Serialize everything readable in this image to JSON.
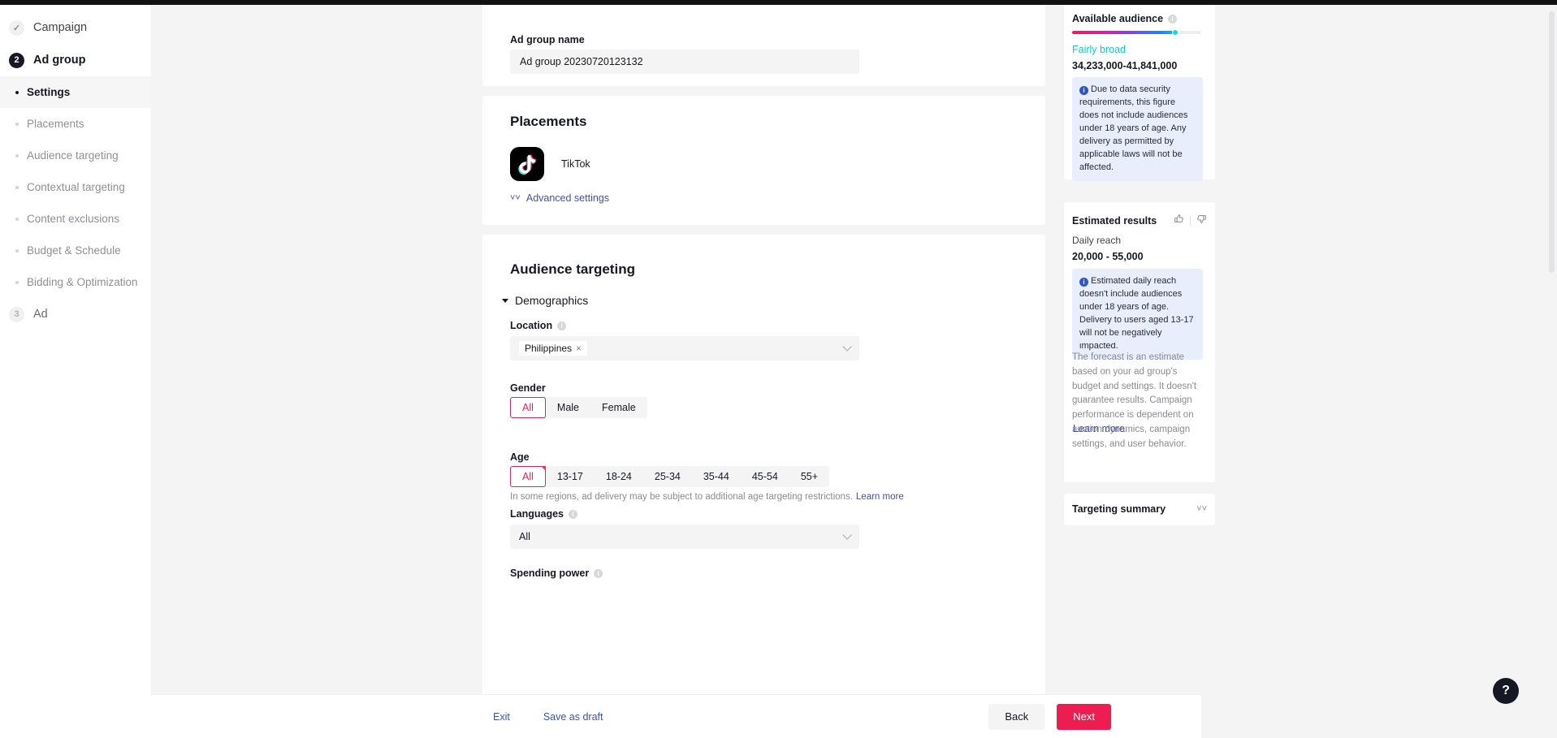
{
  "sidebar": {
    "steps": [
      {
        "badge": "✓",
        "label": "Campaign",
        "state": "done"
      },
      {
        "badge": "2",
        "label": "Ad group",
        "state": "active"
      }
    ],
    "sub_items": [
      {
        "label": "Settings",
        "selected": true
      },
      {
        "label": "Placements",
        "selected": false
      },
      {
        "label": "Audience targeting",
        "selected": false
      },
      {
        "label": "Contextual targeting",
        "selected": false
      },
      {
        "label": "Content exclusions",
        "selected": false
      },
      {
        "label": "Budget & Schedule",
        "selected": false
      },
      {
        "label": "Bidding & Optimization",
        "selected": false
      }
    ],
    "last_step": {
      "badge": "3",
      "label": "Ad",
      "state": "todo"
    }
  },
  "ad_group_name": {
    "label": "Ad group name",
    "value": "Ad group 20230720123132"
  },
  "placements": {
    "title": "Placements",
    "platform": "TikTok",
    "advanced_settings": "Advanced settings"
  },
  "audience_targeting": {
    "title": "Audience targeting",
    "demographics_label": "Demographics",
    "location": {
      "label": "Location",
      "tag": "Philippines",
      "remove": "×"
    },
    "gender": {
      "label": "Gender",
      "options": [
        "All",
        "Male",
        "Female"
      ],
      "selected": "All"
    },
    "age": {
      "label": "Age",
      "options": [
        "All",
        "13-17",
        "18-24",
        "25-34",
        "35-44",
        "45-54",
        "55+"
      ],
      "selected": "All",
      "hint": "In some regions, ad delivery may be subject to additional age targeting restrictions.",
      "hint_link": "Learn more"
    },
    "languages": {
      "label": "Languages",
      "value": "All"
    },
    "spending_power": {
      "label": "Spending power"
    }
  },
  "right_panel": {
    "available_audience": {
      "title": "Available audience",
      "breadth": "Fairly broad",
      "range": "34,233,000-41,841,000",
      "notice": "Due to data security requirements, this figure does not include audiences under 18 years of age. Any delivery as permitted by applicable laws will not be affected.",
      "slider_percent": 78
    },
    "estimated_results": {
      "title": "Estimated results",
      "metric_label": "Daily reach",
      "metric_value": "20,000 - 55,000",
      "notice": "Estimated daily reach doesn't include audiences under 18 years of age. Delivery to users aged 13-17 will not be negatively impacted.",
      "disclaimer": "The forecast is an estimate based on your ad group's budget and settings. It doesn't guarantee results. Campaign performance is dependent on auction dynamics, campaign settings, and user behavior.",
      "learn_more": "Learn more"
    },
    "targeting_summary": {
      "title": "Targeting summary"
    }
  },
  "footer": {
    "exit": "Exit",
    "save_as_draft": "Save as draft",
    "back": "Back",
    "next": "Next"
  },
  "help": {
    "glyph": "?"
  },
  "colors": {
    "accent_pink": "#ee1d51",
    "selected_pill": "#d6285c",
    "link_blue": "#3e50b4",
    "teal": "#14c6c9",
    "notice_bg": "#e8eefc"
  }
}
